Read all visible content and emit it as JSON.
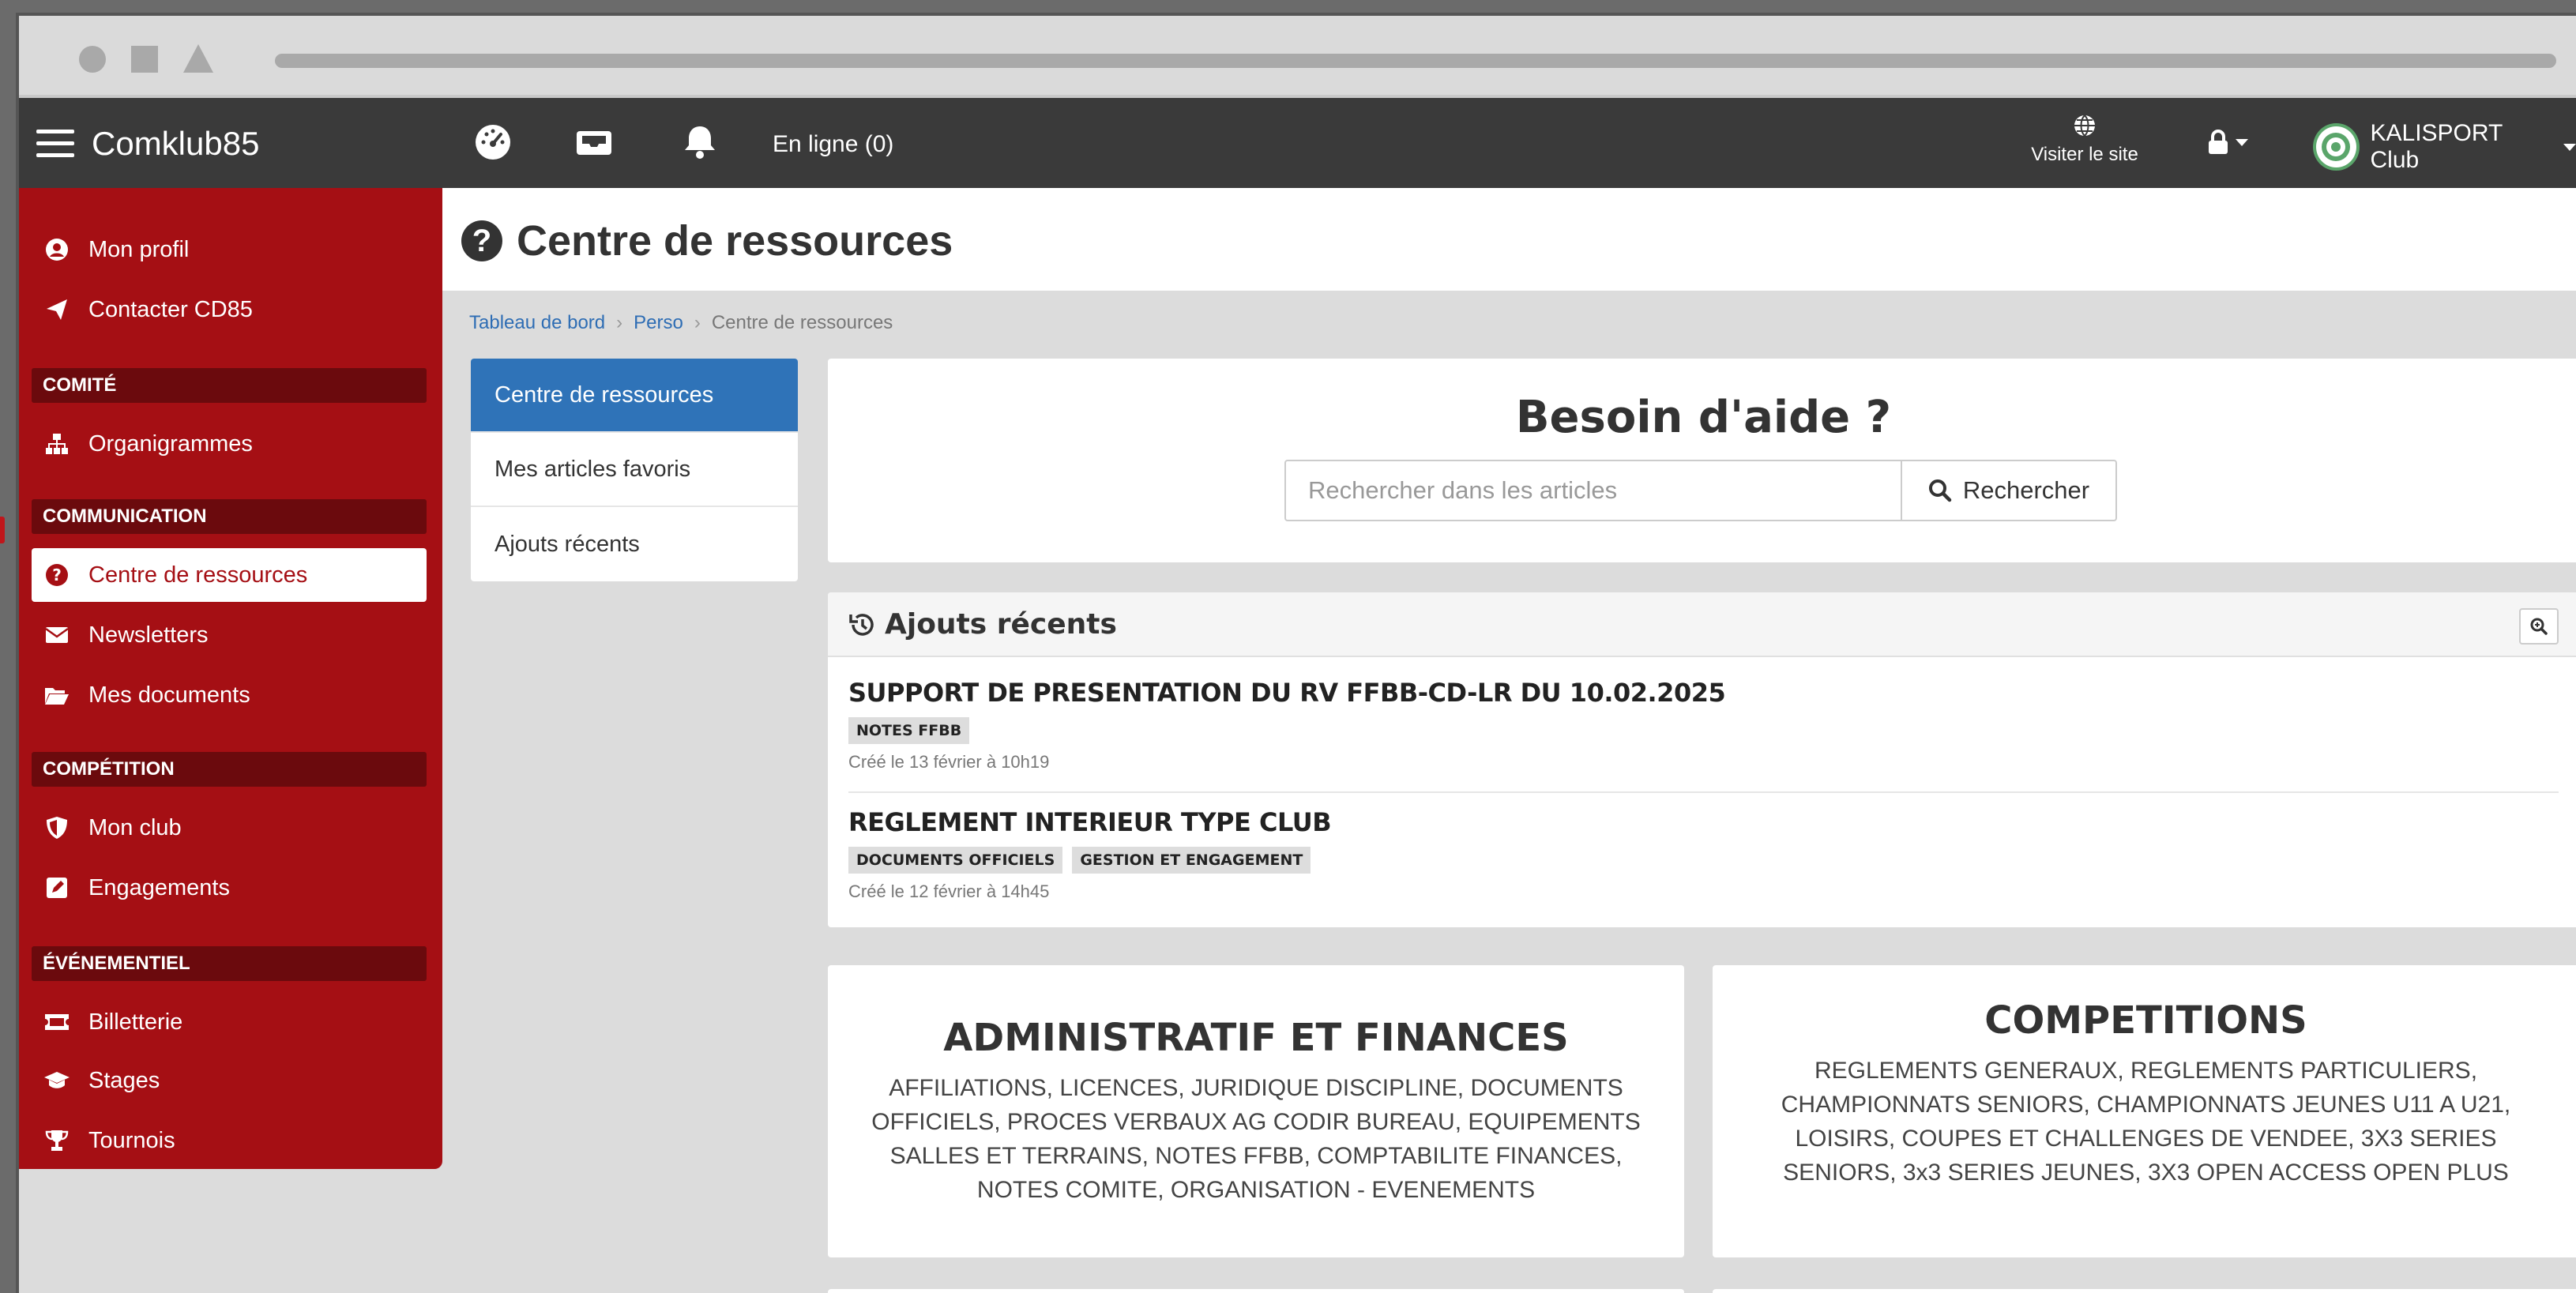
{
  "navbar": {
    "brand": "Comklub85",
    "online": "En ligne (0)",
    "visit_label": "Visiter le site",
    "club_name": "KALISPORT Club"
  },
  "sidebar": {
    "items": [
      {
        "label": "Mon profil",
        "icon": "user-circle-icon"
      },
      {
        "label": "Contacter CD85",
        "icon": "paper-plane-icon"
      },
      {
        "section": "COMITÉ"
      },
      {
        "label": "Organigrammes",
        "icon": "sitemap-icon"
      },
      {
        "section": "COMMUNICATION"
      },
      {
        "label": "Centre de ressources",
        "icon": "question-circle-icon",
        "active": true
      },
      {
        "label": "Newsletters",
        "icon": "envelope-icon"
      },
      {
        "label": "Mes documents",
        "icon": "folder-open-icon"
      },
      {
        "section": "COMPÉTITION"
      },
      {
        "label": "Mon club",
        "icon": "shield-icon"
      },
      {
        "label": "Engagements",
        "icon": "edit-icon"
      },
      {
        "section": "ÉVÉNEMENTIEL"
      },
      {
        "label": "Billetterie",
        "icon": "ticket-icon"
      },
      {
        "label": "Stages",
        "icon": "graduation-cap-icon"
      },
      {
        "label": "Tournois",
        "icon": "trophy-icon"
      }
    ]
  },
  "page": {
    "title": "Centre de ressources",
    "breadcrumb": [
      "Tableau de bord",
      "Perso",
      "Centre de ressources"
    ]
  },
  "submenu": [
    "Centre de ressources",
    "Mes articles favoris",
    "Ajouts récents"
  ],
  "help": {
    "title": "Besoin d'aide ?",
    "search_placeholder": "Rechercher dans les articles",
    "search_button": "Rechercher"
  },
  "recent": {
    "title": "Ajouts récents",
    "articles": [
      {
        "title": "SUPPORT DE PRESENTATION DU RV FFBB-CD-LR DU 10.02.2025",
        "tags": [
          "NOTES FFBB"
        ],
        "date": "Créé le 13 février à 10h19"
      },
      {
        "title": "REGLEMENT INTERIEUR TYPE CLUB",
        "tags": [
          "DOCUMENTS OFFICIELS",
          "GESTION ET ENGAGEMENT"
        ],
        "date": "Créé le 12 février à 14h45"
      }
    ]
  },
  "categories": [
    {
      "title": "ADMINISTRATIF ET FINANCES",
      "desc": "AFFILIATIONS, LICENCES, JURIDIQUE DISCIPLINE, DOCUMENTS OFFICIELS, PROCES VERBAUX AG CODIR BUREAU, EQUIPEMENTS SALLES ET TERRAINS, NOTES FFBB, COMPTABILITE FINANCES, NOTES COMITE, ORGANISATION - EVENEMENTS"
    },
    {
      "title": "COMPETITIONS",
      "desc": "REGLEMENTS GENERAUX, REGLEMENTS PARTICULIERS, CHAMPIONNATS SENIORS, CHAMPIONNATS JEUNES U11 A U21, LOISIRS, COUPES ET CHALLENGES DE VENDEE, 3X3 SERIES SENIORS, 3x3 SERIES JEUNES, 3X3 OPEN ACCESS OPEN PLUS"
    }
  ]
}
